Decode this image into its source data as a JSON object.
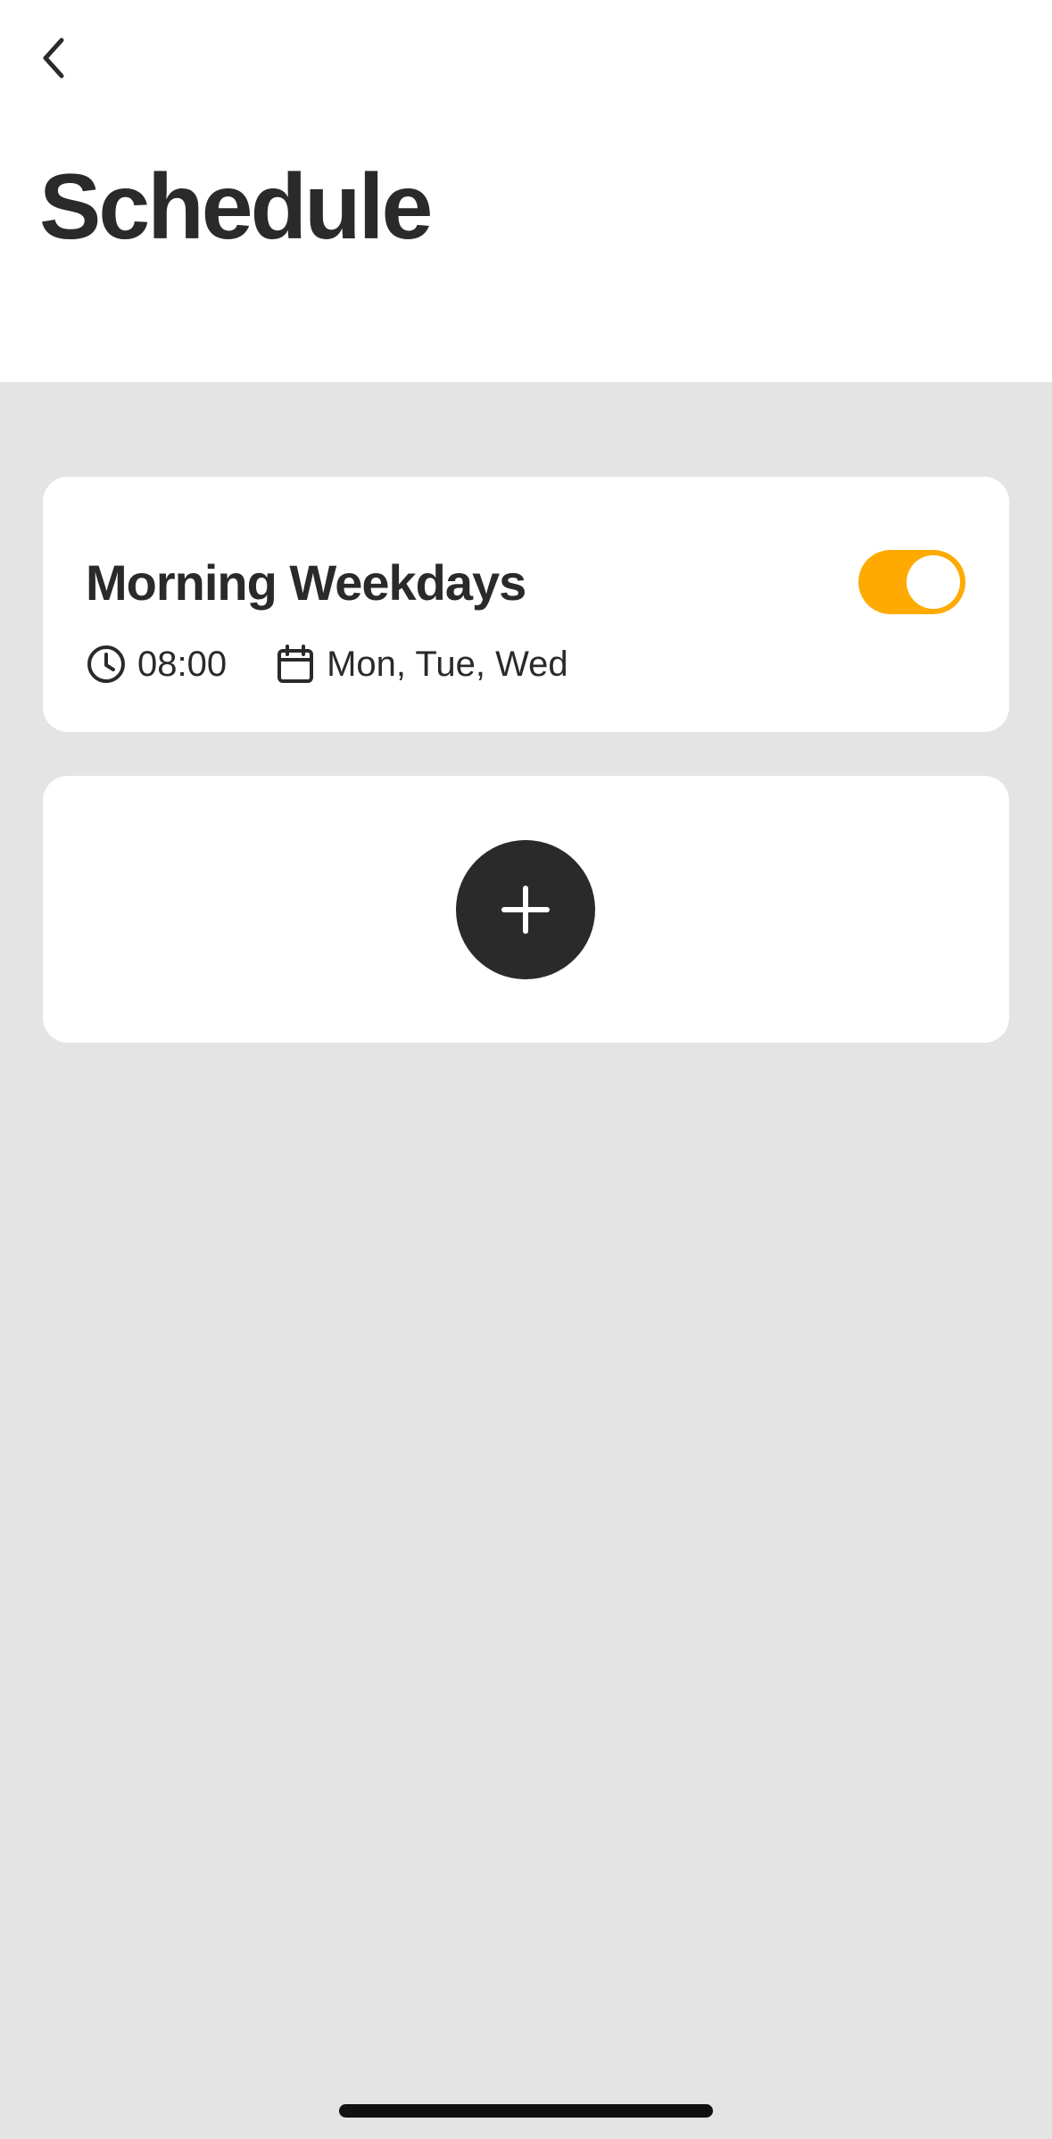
{
  "header": {
    "back_icon": "chevron-left-icon",
    "title": "Schedule"
  },
  "schedules": [
    {
      "name": "Morning Weekdays",
      "enabled": true,
      "time": "08:00",
      "days": "Mon, Tue, Wed",
      "time_icon": "clock-icon",
      "days_icon": "calendar-icon"
    }
  ],
  "add_schedule": {
    "icon": "plus-icon"
  },
  "colors": {
    "accent": "#ffaa00",
    "dark": "#2a2a2a",
    "background": "#e4e4e4",
    "card": "#ffffff"
  }
}
